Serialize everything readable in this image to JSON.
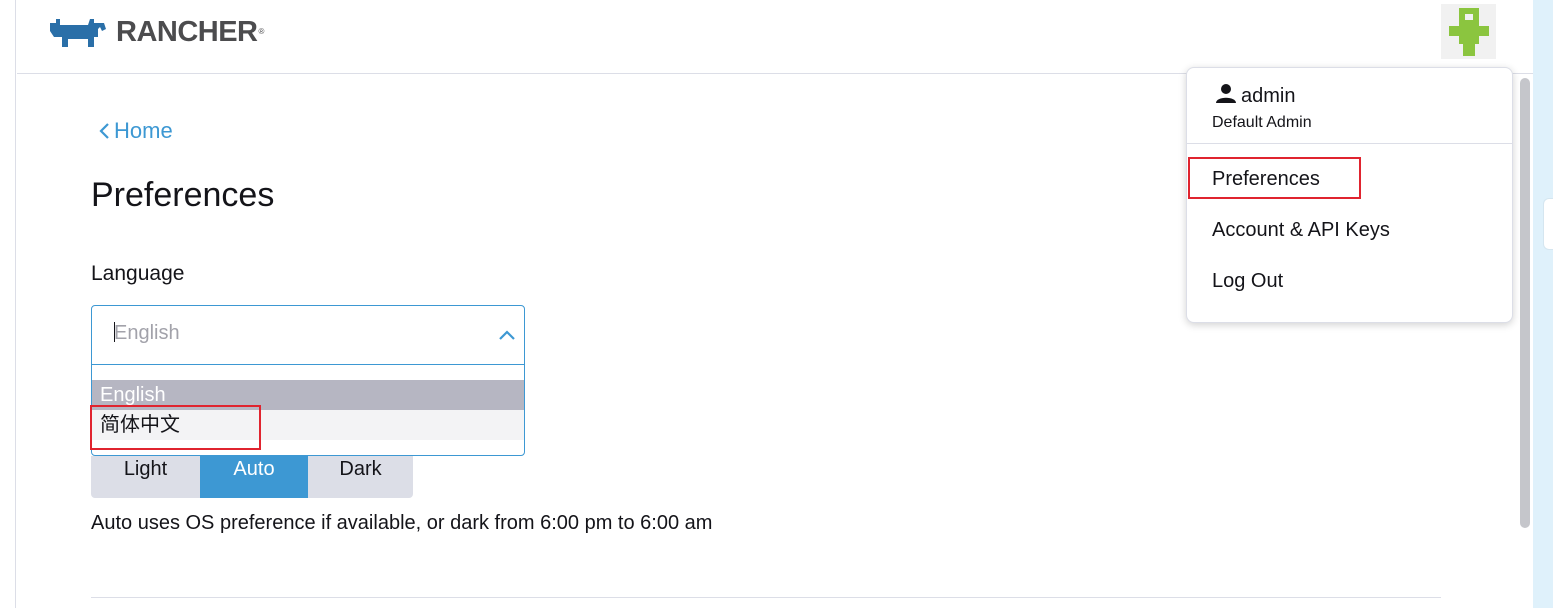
{
  "header": {
    "logo_text": "RANCHER",
    "logo_mark": "®"
  },
  "nav": {
    "back_label": "Home"
  },
  "page": {
    "title": "Preferences"
  },
  "language": {
    "label": "Language",
    "current_value": "English",
    "options": [
      "English",
      "简体中文"
    ],
    "selected_option": "English"
  },
  "theme": {
    "options": [
      "Light",
      "Auto",
      "Dark"
    ],
    "active": "Auto",
    "help_text": "Auto uses OS preference if available, or dark from 6:00 pm to 6:00 am"
  },
  "user_menu": {
    "username": "admin",
    "subtitle": "Default Admin",
    "items": [
      "Preferences",
      "Account & API Keys",
      "Log Out"
    ]
  },
  "colors": {
    "accent": "#3d98d3",
    "highlight_box": "#e0242f",
    "brand_blue": "#2a6fa8",
    "avatar_green": "#8bc53f"
  },
  "icons": {
    "back": "chevron-left-icon",
    "dropdown": "chevron-up-icon",
    "user": "person-icon",
    "logo": "rancher-bull-icon"
  }
}
